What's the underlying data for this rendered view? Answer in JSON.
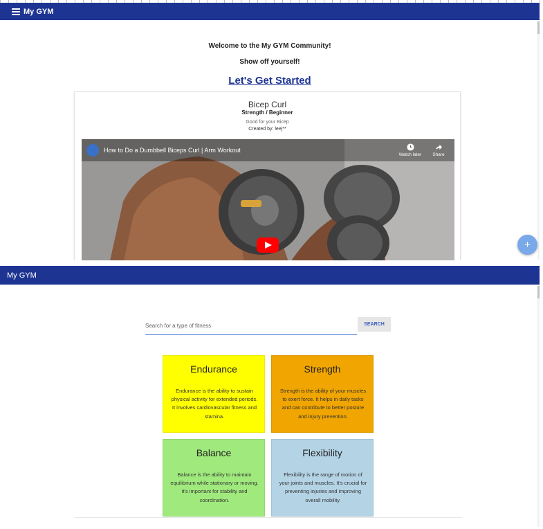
{
  "colors": {
    "appbar": "#1e3493",
    "link": "#1e3493",
    "fab": "#7aa9ea"
  },
  "top": {
    "appbar": {
      "title": "My GYM"
    },
    "welcome": "Welcome to the My GYM Community!",
    "show_off": "Show off yourself!",
    "get_started": "Let's Get Started",
    "card": {
      "title": "Bicep Curl",
      "category": "Strength / Beginner",
      "description": "Good for your Bicep",
      "author": "Created by: leej**",
      "video": {
        "title": "How to Do a Dumbbell Biceps Curl | Arm Workout",
        "watch_later": "Watch later",
        "share": "Share"
      }
    },
    "fab": {
      "icon": "plus-icon",
      "label": "+"
    }
  },
  "bottom": {
    "appbar": {
      "title": "My GYM"
    },
    "search": {
      "placeholder": "Search for a type of fitness",
      "value": "",
      "button_label": "SEARCH"
    },
    "tiles": [
      {
        "title": "Endurance",
        "color": "#ffff00",
        "description": "Endurance is the ability to sustain physical activity for extended periods. It involves cardiovascular fitness and stamina."
      },
      {
        "title": "Strength",
        "color": "#f0a500",
        "description": "Strength is the ability of your muscles to exert force. It helps in daily tasks and can contribute to better posture and injury prevention."
      },
      {
        "title": "Balance",
        "color": "#a0ea7d",
        "description": "Balance is the ability to maintain equilibrium while stationary or moving. It's important for stability and coordination."
      },
      {
        "title": "Flexibility",
        "color": "#b4d4e6",
        "description": "Flexibility is the range of motion of your joints and muscles. It's crucial for preventing injuries and improving overall mobility."
      }
    ]
  }
}
